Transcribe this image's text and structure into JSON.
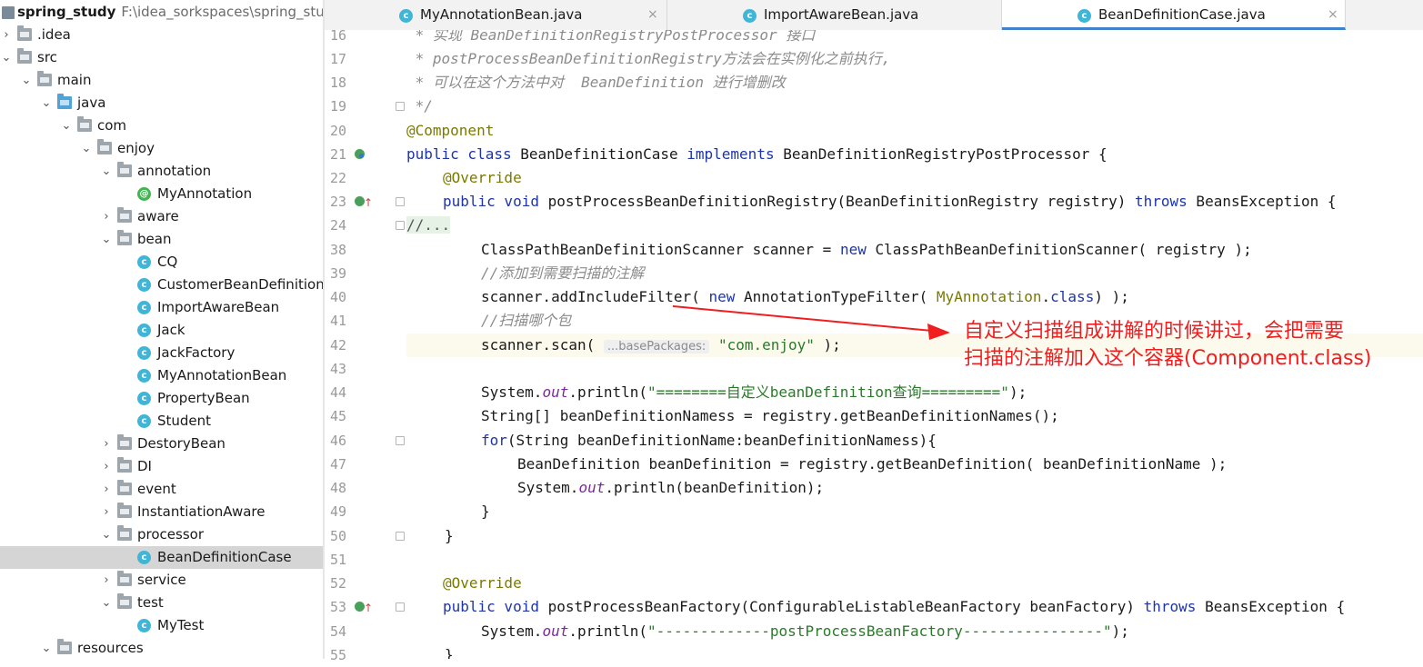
{
  "project": {
    "name": "spring_study",
    "path": "F:\\idea_sorkspaces\\spring_study"
  },
  "tree": [
    {
      "label": ".idea",
      "depth": 0,
      "chevron": ">",
      "icon": "folder"
    },
    {
      "label": "src",
      "depth": 0,
      "chevron": "v",
      "icon": "folder"
    },
    {
      "label": "main",
      "depth": 1,
      "chevron": "v",
      "icon": "folder"
    },
    {
      "label": "java",
      "depth": 2,
      "chevron": "v",
      "icon": "folder-blue"
    },
    {
      "label": "com",
      "depth": 3,
      "chevron": "v",
      "icon": "folder"
    },
    {
      "label": "enjoy",
      "depth": 4,
      "chevron": "v",
      "icon": "folder"
    },
    {
      "label": "annotation",
      "depth": 5,
      "chevron": "v",
      "icon": "folder"
    },
    {
      "label": "MyAnnotation",
      "depth": 6,
      "chevron": "",
      "icon": "annotation"
    },
    {
      "label": "aware",
      "depth": 5,
      "chevron": ">",
      "icon": "folder"
    },
    {
      "label": "bean",
      "depth": 5,
      "chevron": "v",
      "icon": "folder"
    },
    {
      "label": "CQ",
      "depth": 6,
      "chevron": "",
      "icon": "class"
    },
    {
      "label": "CustomerBeanDefinition",
      "depth": 6,
      "chevron": "",
      "icon": "class"
    },
    {
      "label": "ImportAwareBean",
      "depth": 6,
      "chevron": "",
      "icon": "class"
    },
    {
      "label": "Jack",
      "depth": 6,
      "chevron": "",
      "icon": "class"
    },
    {
      "label": "JackFactory",
      "depth": 6,
      "chevron": "",
      "icon": "class"
    },
    {
      "label": "MyAnnotationBean",
      "depth": 6,
      "chevron": "",
      "icon": "class"
    },
    {
      "label": "PropertyBean",
      "depth": 6,
      "chevron": "",
      "icon": "class"
    },
    {
      "label": "Student",
      "depth": 6,
      "chevron": "",
      "icon": "class"
    },
    {
      "label": "DestoryBean",
      "depth": 5,
      "chevron": ">",
      "icon": "folder"
    },
    {
      "label": "DI",
      "depth": 5,
      "chevron": ">",
      "icon": "folder"
    },
    {
      "label": "event",
      "depth": 5,
      "chevron": ">",
      "icon": "folder"
    },
    {
      "label": "InstantiationAware",
      "depth": 5,
      "chevron": ">",
      "icon": "folder"
    },
    {
      "label": "processor",
      "depth": 5,
      "chevron": "v",
      "icon": "folder"
    },
    {
      "label": "BeanDefinitionCase",
      "depth": 6,
      "chevron": "",
      "icon": "class",
      "selected": true
    },
    {
      "label": "service",
      "depth": 5,
      "chevron": ">",
      "icon": "folder"
    },
    {
      "label": "test",
      "depth": 5,
      "chevron": "v",
      "icon": "folder"
    },
    {
      "label": "MyTest",
      "depth": 6,
      "chevron": "",
      "icon": "class"
    },
    {
      "label": "resources",
      "depth": 2,
      "chevron": "v",
      "icon": "folder"
    }
  ],
  "tabs": [
    {
      "label": "MyAnnotationBean.java",
      "active": false
    },
    {
      "label": "ImportAwareBean.java",
      "active": false
    },
    {
      "label": "BeanDefinitionCase.java",
      "active": true
    }
  ],
  "tab_close_glyph": "×",
  "line_numbers": [
    "16",
    "17",
    "18",
    "19",
    "20",
    "21",
    "22",
    "23",
    "24",
    "38",
    "39",
    "40",
    "41",
    "42",
    "43",
    "44",
    "45",
    "46",
    "47",
    "48",
    "49",
    "50",
    "51",
    "52",
    "53",
    "54",
    "55"
  ],
  "code": {
    "l16": " * 实现 BeanDefinitionRegistryPostProcessor 接口",
    "l17": " * postProcessBeanDefinitionRegistry方法会在实例化之前执行,",
    "l18": " * 可以在这个方法中对  BeanDefinition 进行增删改",
    "l19": " */",
    "l20": "@Component",
    "l21_kw": "public class",
    "l21_rest": " BeanDefinitionCase ",
    "l21_kw2": "implements",
    "l21_tail": " BeanDefinitionRegistryPostProcessor {",
    "l22": "@Override",
    "l23_kw": "public void",
    "l23_mid": " postProcessBeanDefinitionRegistry(BeanDefinitionRegistry registry) ",
    "l23_kw2": "throws",
    "l23_tail": " BeansException {",
    "l24": "//...",
    "l38_a": "ClassPathBeanDefinitionScanner scanner = ",
    "l38_kw": "new",
    "l38_b": " ClassPathBeanDefinitionScanner( registry );",
    "l39": "//添加到需要扫描的注解",
    "l40_a": "scanner.addIncludeFilter( ",
    "l40_kw": "new",
    "l40_b": " AnnotationTypeFilter( ",
    "l40_ann": "MyAnnotation",
    "l40_c": ".",
    "l40_kw2": "class",
    "l40_d": ") );",
    "l41": "//扫描哪个包",
    "l42_a": "scanner.scan( ",
    "l42_hint": "...basePackages:",
    "l42_str": "\"com.enjoy\"",
    "l42_b": " );",
    "l44_a": "System.",
    "l44_fld": "out",
    "l44_b": ".println(",
    "l44_str": "\"========自定义beanDefinition查询=========\"",
    "l44_c": ");",
    "l45": "String[] beanDefinitionNamess = registry.getBeanDefinitionNames();",
    "l46_kw": "for",
    "l46_rest": "(String beanDefinitionName:beanDefinitionNamess){",
    "l47": "BeanDefinition beanDefinition = registry.getBeanDefinition( beanDefinitionName );",
    "l48_a": "System.",
    "l48_fld": "out",
    "l48_b": ".println(beanDefinition);",
    "l49": "}",
    "l50": "}",
    "l52": "@Override",
    "l53_kw": "public void",
    "l53_mid": " postProcessBeanFactory(ConfigurableListableBeanFactory beanFactory) ",
    "l53_kw2": "throws",
    "l53_tail": " BeansException {",
    "l54_a": "System.",
    "l54_fld": "out",
    "l54_b": ".println(",
    "l54_str": "\"-------------postProcessBeanFactory----------------\"",
    "l54_c": ");",
    "l55": "}"
  },
  "annotation_callout": {
    "line1": "自定义扫描组成讲解的时候讲过，会把需要",
    "line2": "扫描的注解加入这个容器(Component.class)",
    "color": "#f01e1e"
  }
}
